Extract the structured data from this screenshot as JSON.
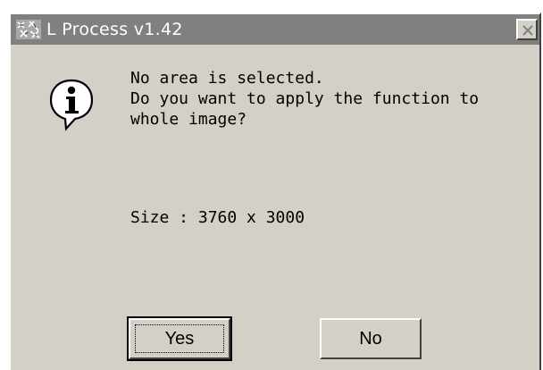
{
  "window": {
    "title": "L Process v1.42",
    "app_icon": "app-icon",
    "close_icon": "close-icon"
  },
  "message": {
    "icon": "info-icon",
    "lines": [
      "No area is selected.",
      "Do you want to apply the function to",
      "whole image?"
    ],
    "size_text": "Size : 3760 x 3000"
  },
  "buttons": {
    "yes_label": "Yes",
    "no_label": "No"
  },
  "colors": {
    "face": "#d4d0c8",
    "titlebar": "#808080",
    "title_text": "#ffffff",
    "text": "#000000"
  }
}
